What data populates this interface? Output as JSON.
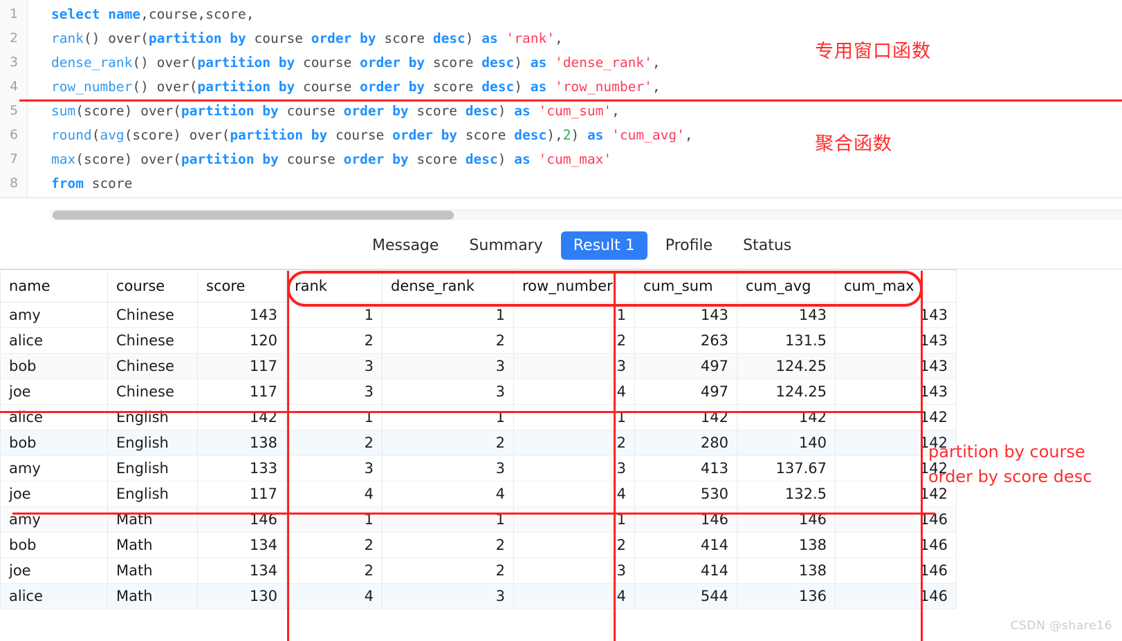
{
  "editor": {
    "lines": [
      {
        "no": "1",
        "tokens": [
          {
            "t": "select ",
            "c": "kw"
          },
          {
            "t": "name",
            "c": "kw"
          },
          {
            "t": ",course,score,",
            "c": "pln"
          }
        ]
      },
      {
        "no": "2",
        "tokens": [
          {
            "t": "rank",
            "c": "fn"
          },
          {
            "t": "() over(",
            "c": "pln"
          },
          {
            "t": "partition by ",
            "c": "kw"
          },
          {
            "t": "course ",
            "c": "pln"
          },
          {
            "t": "order by ",
            "c": "kw"
          },
          {
            "t": "score ",
            "c": "pln"
          },
          {
            "t": "desc",
            "c": "kw"
          },
          {
            "t": ") ",
            "c": "pln"
          },
          {
            "t": "as ",
            "c": "kw"
          },
          {
            "t": "'rank'",
            "c": "str"
          },
          {
            "t": ",",
            "c": "pln"
          }
        ]
      },
      {
        "no": "3",
        "tokens": [
          {
            "t": "dense_rank",
            "c": "fn"
          },
          {
            "t": "() over(",
            "c": "pln"
          },
          {
            "t": "partition by ",
            "c": "kw"
          },
          {
            "t": "course ",
            "c": "pln"
          },
          {
            "t": "order by ",
            "c": "kw"
          },
          {
            "t": "score ",
            "c": "pln"
          },
          {
            "t": "desc",
            "c": "kw"
          },
          {
            "t": ") ",
            "c": "pln"
          },
          {
            "t": "as ",
            "c": "kw"
          },
          {
            "t": "'dense_rank'",
            "c": "str"
          },
          {
            "t": ",",
            "c": "pln"
          }
        ]
      },
      {
        "no": "4",
        "tokens": [
          {
            "t": "row_number",
            "c": "fn"
          },
          {
            "t": "() over(",
            "c": "pln"
          },
          {
            "t": "partition by ",
            "c": "kw"
          },
          {
            "t": "course ",
            "c": "pln"
          },
          {
            "t": "order by ",
            "c": "kw"
          },
          {
            "t": "score ",
            "c": "pln"
          },
          {
            "t": "desc",
            "c": "kw"
          },
          {
            "t": ") ",
            "c": "pln"
          },
          {
            "t": "as ",
            "c": "kw"
          },
          {
            "t": "'row_number'",
            "c": "str"
          },
          {
            "t": ",",
            "c": "pln"
          }
        ]
      },
      {
        "no": "5",
        "tokens": [
          {
            "t": "sum",
            "c": "fn"
          },
          {
            "t": "(score) over(",
            "c": "pln"
          },
          {
            "t": "partition by ",
            "c": "kw"
          },
          {
            "t": "course ",
            "c": "pln"
          },
          {
            "t": "order by ",
            "c": "kw"
          },
          {
            "t": "score ",
            "c": "pln"
          },
          {
            "t": "desc",
            "c": "kw"
          },
          {
            "t": ") ",
            "c": "pln"
          },
          {
            "t": "as ",
            "c": "kw"
          },
          {
            "t": "'cum_sum'",
            "c": "str"
          },
          {
            "t": ",",
            "c": "pln"
          }
        ]
      },
      {
        "no": "6",
        "tokens": [
          {
            "t": "round",
            "c": "fn"
          },
          {
            "t": "(",
            "c": "pln"
          },
          {
            "t": "avg",
            "c": "fn"
          },
          {
            "t": "(score) over(",
            "c": "pln"
          },
          {
            "t": "partition by ",
            "c": "kw"
          },
          {
            "t": "course ",
            "c": "pln"
          },
          {
            "t": "order by ",
            "c": "kw"
          },
          {
            "t": "score ",
            "c": "pln"
          },
          {
            "t": "desc",
            "c": "kw"
          },
          {
            "t": "),",
            "c": "pln"
          },
          {
            "t": "2",
            "c": "num"
          },
          {
            "t": ") ",
            "c": "pln"
          },
          {
            "t": "as ",
            "c": "kw"
          },
          {
            "t": "'cum_avg'",
            "c": "str"
          },
          {
            "t": ",",
            "c": "pln"
          }
        ]
      },
      {
        "no": "7",
        "tokens": [
          {
            "t": "max",
            "c": "fn"
          },
          {
            "t": "(score) over(",
            "c": "pln"
          },
          {
            "t": "partition by ",
            "c": "kw"
          },
          {
            "t": "course ",
            "c": "pln"
          },
          {
            "t": "order by ",
            "c": "kw"
          },
          {
            "t": "score ",
            "c": "pln"
          },
          {
            "t": "desc",
            "c": "kw"
          },
          {
            "t": ") ",
            "c": "pln"
          },
          {
            "t": "as ",
            "c": "kw"
          },
          {
            "t": "'cum_max'",
            "c": "str"
          }
        ]
      },
      {
        "no": "8",
        "tokens": [
          {
            "t": "from ",
            "c": "kw"
          },
          {
            "t": "score",
            "c": "pln"
          }
        ]
      }
    ]
  },
  "tabs": [
    {
      "label": "Message",
      "active": false
    },
    {
      "label": "Summary",
      "active": false
    },
    {
      "label": "Result 1",
      "active": true
    },
    {
      "label": "Profile",
      "active": false
    },
    {
      "label": "Status",
      "active": false
    }
  ],
  "result_table": {
    "columns": [
      "name",
      "course",
      "score",
      "rank",
      "dense_rank",
      "row_number",
      "cum_sum",
      "cum_avg",
      "cum_max"
    ],
    "rows": [
      {
        "cells": [
          "amy",
          "Chinese",
          "143",
          "1",
          "1",
          "1",
          "143",
          "143",
          "143"
        ],
        "bg": "white"
      },
      {
        "cells": [
          "alice",
          "Chinese",
          "120",
          "2",
          "2",
          "2",
          "263",
          "131.5",
          "143"
        ],
        "bg": "white"
      },
      {
        "cells": [
          "bob",
          "Chinese",
          "117",
          "3",
          "3",
          "3",
          "497",
          "124.25",
          "143"
        ],
        "bg": "gray"
      },
      {
        "cells": [
          "joe",
          "Chinese",
          "117",
          "3",
          "3",
          "4",
          "497",
          "124.25",
          "143"
        ],
        "bg": "white"
      },
      {
        "cells": [
          "alice",
          "English",
          "142",
          "1",
          "1",
          "1",
          "142",
          "142",
          "142"
        ],
        "bg": "white"
      },
      {
        "cells": [
          "bob",
          "English",
          "138",
          "2",
          "2",
          "2",
          "280",
          "140",
          "142"
        ],
        "bg": "blue"
      },
      {
        "cells": [
          "amy",
          "English",
          "133",
          "3",
          "3",
          "3",
          "413",
          "137.67",
          "142"
        ],
        "bg": "white"
      },
      {
        "cells": [
          "joe",
          "English",
          "117",
          "4",
          "4",
          "4",
          "530",
          "132.5",
          "142"
        ],
        "bg": "white"
      },
      {
        "cells": [
          "amy",
          "Math",
          "146",
          "1",
          "1",
          "1",
          "146",
          "146",
          "146"
        ],
        "bg": "gray"
      },
      {
        "cells": [
          "bob",
          "Math",
          "134",
          "2",
          "2",
          "2",
          "414",
          "138",
          "146"
        ],
        "bg": "white"
      },
      {
        "cells": [
          "joe",
          "Math",
          "134",
          "2",
          "2",
          "3",
          "414",
          "138",
          "146"
        ],
        "bg": "white"
      },
      {
        "cells": [
          "alice",
          "Math",
          "130",
          "4",
          "3",
          "4",
          "544",
          "136",
          "146"
        ],
        "bg": "blue"
      }
    ]
  },
  "annotations": {
    "window_functions_label": "专用窗口函数",
    "aggregate_functions_label": "聚合函数",
    "partition_label_line1": "partition by course",
    "partition_label_line2": "order by score desc",
    "color": "#FF2020"
  },
  "watermark": "CSDN @share16"
}
